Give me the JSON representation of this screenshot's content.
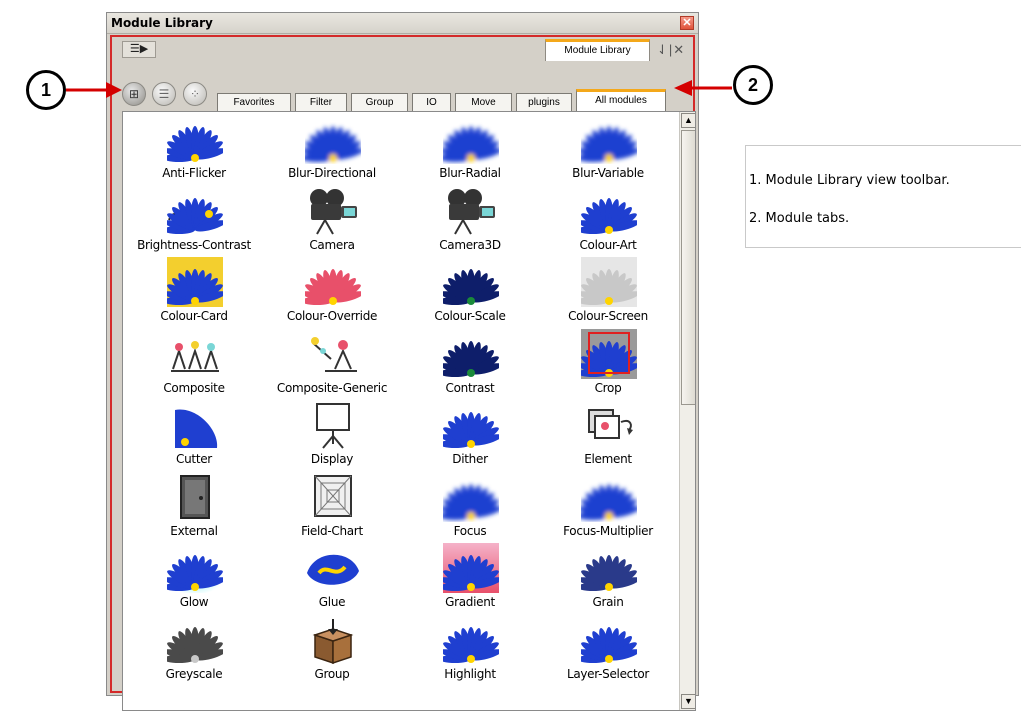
{
  "window": {
    "title": "Module Library",
    "close_glyph": "✕",
    "menu_glyph": "☰▶",
    "view_tab_label": "Module Library",
    "tab_actions_glyph": "⇃|✕"
  },
  "toolbar": {
    "buttons": [
      {
        "icon": "tree-view-icon",
        "glyph": "⊞"
      },
      {
        "icon": "list-view-icon",
        "glyph": "☰"
      },
      {
        "icon": "thumbnail-view-icon",
        "glyph": "⁘"
      }
    ]
  },
  "module_tabs": [
    {
      "label": "Favorites"
    },
    {
      "label": "Filter"
    },
    {
      "label": "Group"
    },
    {
      "label": "IO"
    },
    {
      "label": "Move"
    },
    {
      "label": "plugins"
    },
    {
      "label": "All modules",
      "active": true
    }
  ],
  "modules": [
    {
      "label": "Anti-Flicker",
      "icon": "blue-flower-icon"
    },
    {
      "label": "Blur-Directional",
      "icon": "blurred-flower-icon"
    },
    {
      "label": "Blur-Radial",
      "icon": "blurred-flower-icon"
    },
    {
      "label": "Blur-Variable",
      "icon": "blurred-flower-icon"
    },
    {
      "label": "Brightness-Contrast",
      "icon": "plug-flower-icon"
    },
    {
      "label": "Camera",
      "icon": "camera-icon"
    },
    {
      "label": "Camera3D",
      "icon": "camera-icon"
    },
    {
      "label": "Colour-Art",
      "icon": "blue-flower-icon"
    },
    {
      "label": "Colour-Card",
      "icon": "yellow-card-flower-icon"
    },
    {
      "label": "Colour-Override",
      "icon": "pink-flower-icon"
    },
    {
      "label": "Colour-Scale",
      "icon": "dark-flower-icon"
    },
    {
      "label": "Colour-Screen",
      "icon": "checker-flower-icon"
    },
    {
      "label": "Composite",
      "icon": "composite-icon"
    },
    {
      "label": "Composite-Generic",
      "icon": "composite-generic-icon"
    },
    {
      "label": "Contrast",
      "icon": "dark-flower-icon"
    },
    {
      "label": "Crop",
      "icon": "crop-flower-icon"
    },
    {
      "label": "Cutter",
      "icon": "cut-flower-icon"
    },
    {
      "label": "Display",
      "icon": "display-screen-icon"
    },
    {
      "label": "Dither",
      "icon": "blue-flower-icon"
    },
    {
      "label": "Element",
      "icon": "element-icon"
    },
    {
      "label": "External",
      "icon": "door-icon"
    },
    {
      "label": "Field-Chart",
      "icon": "field-chart-icon"
    },
    {
      "label": "Focus",
      "icon": "blurred-flower-icon"
    },
    {
      "label": "Focus-Multiplier",
      "icon": "blurred-flower-icon"
    },
    {
      "label": "Glow",
      "icon": "glow-flower-icon"
    },
    {
      "label": "Glue",
      "icon": "glue-flower-icon"
    },
    {
      "label": "Gradient",
      "icon": "gradient-flower-icon"
    },
    {
      "label": "Grain",
      "icon": "grain-flower-icon"
    },
    {
      "label": "Greyscale",
      "icon": "grey-flower-icon"
    },
    {
      "label": "Group",
      "icon": "group-box-icon"
    },
    {
      "label": "Highlight",
      "icon": "blue-flower-icon"
    },
    {
      "label": "Layer-Selector",
      "icon": "blue-flower-icon"
    }
  ],
  "scrollbar": {
    "up_glyph": "▲",
    "down_glyph": "▼"
  },
  "callouts": [
    {
      "number": "1"
    },
    {
      "number": "2"
    }
  ],
  "notes": [
    "1. Module Library view toolbar.",
    "2. Module tabs."
  ],
  "colors": {
    "accent": "#f4a81a",
    "highlight_border": "#d42a2a",
    "flower_blue": "#1f3fd0"
  }
}
